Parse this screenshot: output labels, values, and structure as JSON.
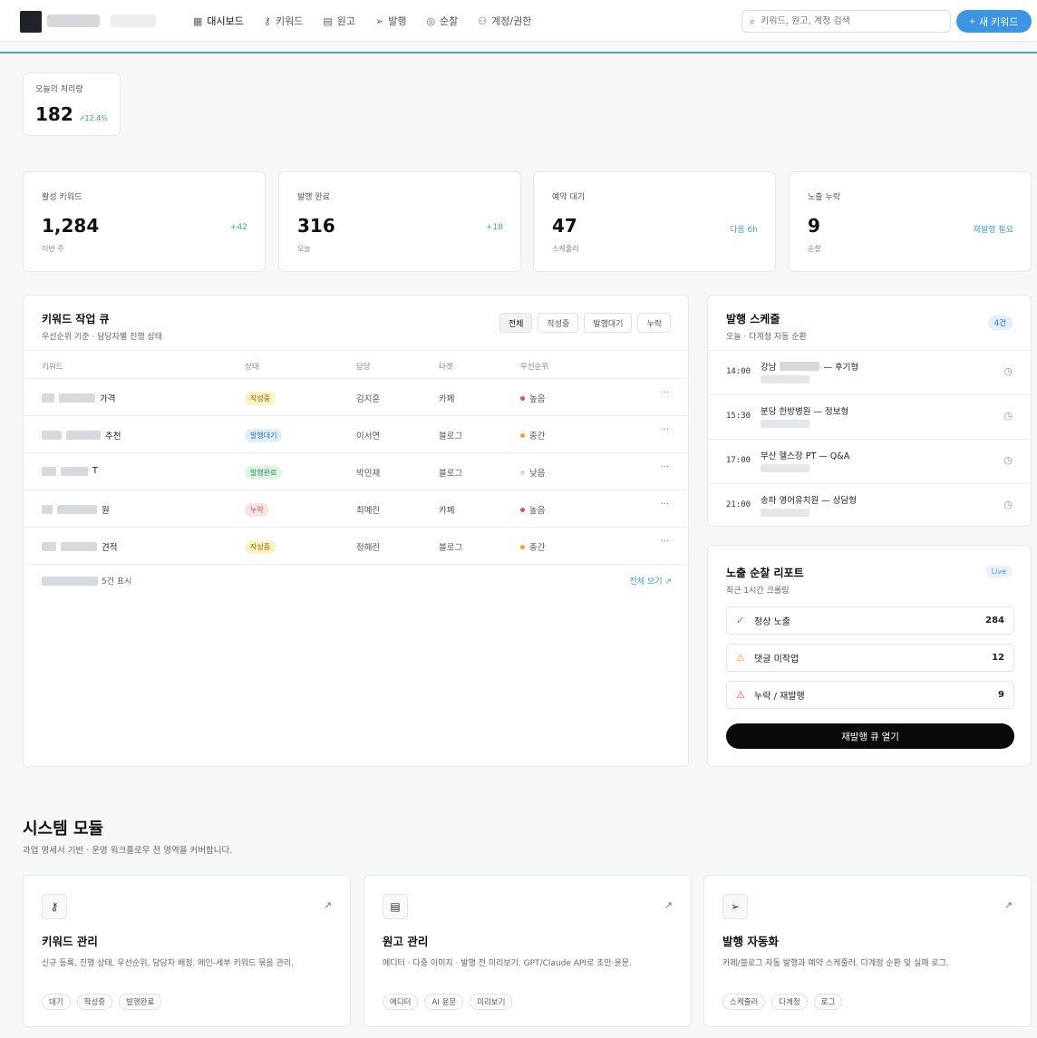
{
  "nav": {
    "items": [
      {
        "label": "대시보드",
        "icon": "grid-icon",
        "glyph": "▦"
      },
      {
        "label": "키워드",
        "icon": "key-icon",
        "glyph": "⚷"
      },
      {
        "label": "원고",
        "icon": "document-icon",
        "glyph": "▤"
      },
      {
        "label": "발행",
        "icon": "send-icon",
        "glyph": "➢"
      },
      {
        "label": "순찰",
        "icon": "radar-icon",
        "glyph": "◎"
      },
      {
        "label": "계정/권한",
        "icon": "users-icon",
        "glyph": "⚇"
      }
    ],
    "search_placeholder": "키워드, 원고, 계정 검색",
    "new_button": "새 키워드"
  },
  "today": {
    "label": "오늘의 처리량",
    "value": "182",
    "delta": "↗12.4%"
  },
  "stats": [
    {
      "label": "활성 키워드",
      "value": "1,284",
      "sub": "이번 주",
      "side": "+42"
    },
    {
      "label": "발행 완료",
      "value": "316",
      "sub": "오늘",
      "side": "+18"
    },
    {
      "label": "예약 대기",
      "value": "47",
      "sub": "스케줄러",
      "side": "다음 6h"
    },
    {
      "label": "노출 누락",
      "value": "9",
      "sub": "순찰",
      "side": "재발행 필요"
    }
  ],
  "queue": {
    "title": "키워드 작업 큐",
    "subtitle": "우선순위 기준 · 담당자별 진행 상태",
    "filters": [
      "전체",
      "작성중",
      "발행대기",
      "누락"
    ],
    "columns": [
      "키워드",
      "상태",
      "담당",
      "타겟",
      "우선순위"
    ],
    "rows": [
      {
        "kw_suffix": "가격",
        "status": "작성중",
        "status_class": "b-write",
        "owner": "김지훈",
        "channel": "카페",
        "priority": "높음",
        "pcolor": "#e05050"
      },
      {
        "kw_suffix": "추천",
        "status": "발행대기",
        "status_class": "b-wait",
        "owner": "이서연",
        "channel": "블로그",
        "priority": "중간",
        "pcolor": "#e8a530"
      },
      {
        "kw_suffix": "T",
        "status": "발행완료",
        "status_class": "b-done",
        "owner": "박민재",
        "channel": "블로그",
        "priority": "낮음",
        "pcolor": "#d5d7da"
      },
      {
        "kw_suffix": "원",
        "status": "누락",
        "status_class": "b-miss",
        "owner": "최예린",
        "channel": "카페",
        "priority": "높음",
        "pcolor": "#e05050"
      },
      {
        "kw_suffix": "견적",
        "status": "작성중",
        "status_class": "b-write",
        "owner": "정해린",
        "channel": "블로그",
        "priority": "중간",
        "pcolor": "#e8a530"
      }
    ],
    "footer_text": "5건 표시",
    "footer_link": "전체 보기 ↗"
  },
  "schedule": {
    "title": "발행 스케줄",
    "subtitle": "오늘 · 다계정 자동 순환",
    "count": "4건",
    "items": [
      {
        "time": "14:00",
        "name_prefix": "강남",
        "name_suffix": "— 후기형"
      },
      {
        "time": "15:30",
        "name_prefix": "분당 한방병원 — 정보형",
        "name_suffix": ""
      },
      {
        "time": "17:00",
        "name_prefix": "부산 헬스장 PT — Q&A",
        "name_suffix": ""
      },
      {
        "time": "21:00",
        "name_prefix": "송파 영어유치원 — 상담형",
        "name_suffix": ""
      }
    ]
  },
  "report": {
    "title": "노출 순찰 리포트",
    "subtitle": "최근 1시간 크롤링",
    "live": "Live",
    "rows": [
      {
        "label": "정상 노출",
        "count": "284",
        "icon": "check-circle-icon",
        "glyph": "✓",
        "color": "#3aa86b"
      },
      {
        "label": "댓글 미작업",
        "count": "12",
        "icon": "warning-icon",
        "glyph": "⚠",
        "color": "#e8a530"
      },
      {
        "label": "누락 / 재발행",
        "count": "9",
        "icon": "alert-icon",
        "glyph": "⚠",
        "color": "#e05050"
      }
    ],
    "button": "재발행 큐 열기"
  },
  "modules": {
    "title": "시스템 모듈",
    "subtitle": "과업 명세서 기반 · 운영 워크플로우 전 영역을 커버합니다.",
    "items": [
      {
        "title": "키워드 관리",
        "icon": "key-icon",
        "glyph": "⚷",
        "desc": "신규 등록, 진행 상태, 우선순위, 담당자 배정. 메인-세부 키워드 묶음 관리.",
        "tags": [
          "대기",
          "작성중",
          "발행완료"
        ]
      },
      {
        "title": "원고 관리",
        "icon": "document-icon",
        "glyph": "▤",
        "desc": "에디터 · 다중 이미지 · 발행 전 미리보기. GPT/Claude API로 초안·윤문.",
        "tags": [
          "에디터",
          "AI 윤문",
          "미리보기"
        ]
      },
      {
        "title": "발행 자동화",
        "icon": "send-icon",
        "glyph": "➢",
        "desc": "카페/블로그 자동 발행과 예약 스케줄러. 다계정 순환 및 실패 로그.",
        "tags": [
          "스케줄러",
          "다계정",
          "로그"
        ]
      }
    ]
  }
}
